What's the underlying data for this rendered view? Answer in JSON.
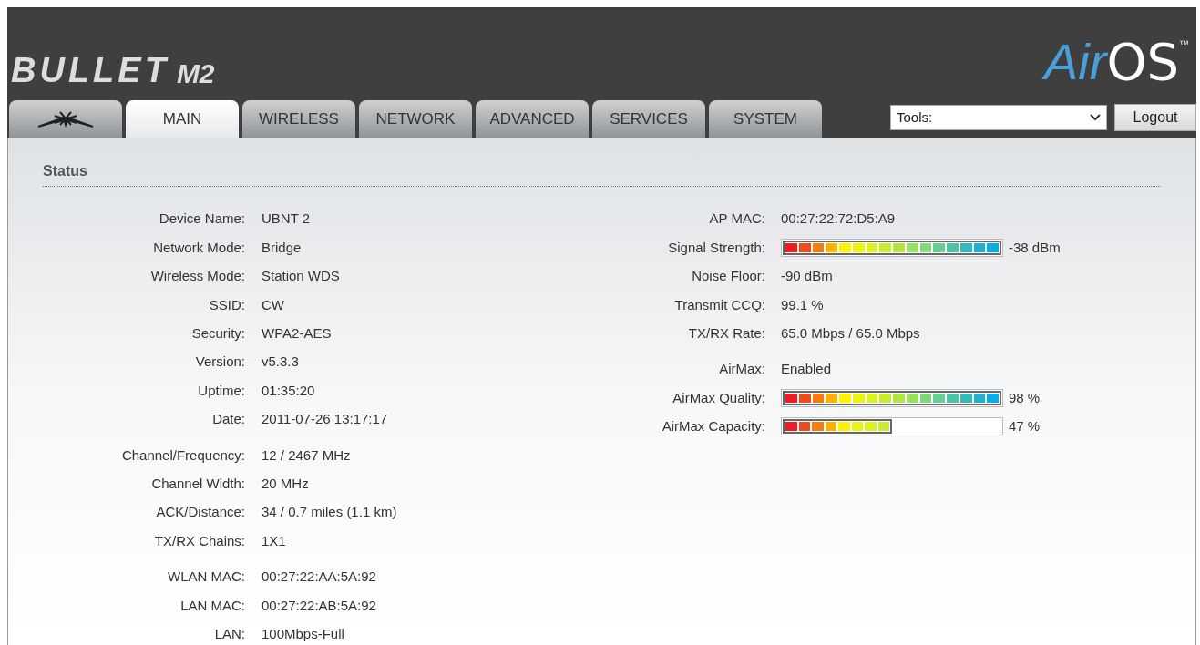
{
  "header": {
    "product": "BULLET",
    "model": "M2",
    "brand_air": "Air",
    "brand_os": "OS",
    "trademark": "™"
  },
  "tabs": [
    {
      "kind": "icon",
      "selected": false
    },
    {
      "kind": "text",
      "label": "MAIN",
      "selected": true
    },
    {
      "kind": "text",
      "label": "WIRELESS",
      "selected": false
    },
    {
      "kind": "text",
      "label": "NETWORK",
      "selected": false
    },
    {
      "kind": "text",
      "label": "ADVANCED",
      "selected": false
    },
    {
      "kind": "text",
      "label": "SERVICES",
      "selected": false
    },
    {
      "kind": "text",
      "label": "SYSTEM",
      "selected": false
    }
  ],
  "tools": {
    "value": "Tools:"
  },
  "logout": "Logout",
  "status": {
    "title": "Status",
    "left": [
      [
        {
          "label": "Device Name:",
          "value": "UBNT 2"
        },
        {
          "label": "Network Mode:",
          "value": "Bridge"
        },
        {
          "label": "Wireless Mode:",
          "value": "Station WDS"
        },
        {
          "label": "SSID:",
          "value": "CW"
        },
        {
          "label": "Security:",
          "value": "WPA2-AES"
        },
        {
          "label": "Version:",
          "value": "v5.3.3"
        },
        {
          "label": "Uptime:",
          "value": "01:35:20"
        },
        {
          "label": "Date:",
          "value": "2011-07-26 13:17:17"
        }
      ],
      [
        {
          "label": "Channel/Frequency:",
          "value": "12 / 2467 MHz"
        },
        {
          "label": "Channel Width:",
          "value": "20 MHz"
        },
        {
          "label": "ACK/Distance:",
          "value": "34 / 0.7 miles (1.1 km)"
        },
        {
          "label": "TX/RX Chains:",
          "value": "1X1"
        }
      ],
      [
        {
          "label": "WLAN MAC:",
          "value": "00:27:22:AA:5A:92"
        },
        {
          "label": "LAN MAC:",
          "value": "00:27:22:AB:5A:92"
        },
        {
          "label": "LAN:",
          "value": "100Mbps-Full"
        }
      ]
    ],
    "right": [
      [
        {
          "kind": "text",
          "label": "AP MAC:",
          "value": "00:27:22:72:D5:A9"
        },
        {
          "kind": "meter",
          "label": "Signal Strength:",
          "level": 1,
          "value": "-38 dBm"
        },
        {
          "kind": "text",
          "label": "Noise Floor:",
          "value": "-90 dBm"
        },
        {
          "kind": "text",
          "label": "Transmit CCQ:",
          "value": "99.1 %"
        },
        {
          "kind": "text",
          "label": "TX/RX Rate:",
          "value": "65.0 Mbps / 65.0 Mbps"
        }
      ],
      [
        {
          "kind": "text",
          "label": "AirMax:",
          "value": "Enabled"
        },
        {
          "kind": "meter",
          "label": "AirMax Quality:",
          "level": 0.98,
          "value": "98 %"
        },
        {
          "kind": "meter",
          "label": "AirMax Capacity:",
          "level": 0.47,
          "value": "47 %"
        }
      ]
    ]
  }
}
